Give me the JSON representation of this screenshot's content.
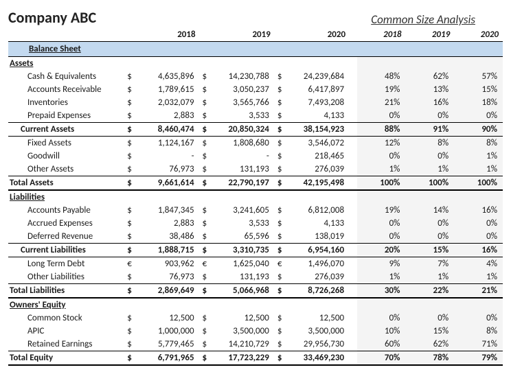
{
  "company": "Company ABC",
  "csa_title": "Common Size Analysis",
  "years": [
    "2018",
    "2019",
    "2020"
  ],
  "section_band": "Balance Sheet",
  "sections": [
    {
      "title": "Assets",
      "rows": [
        {
          "label": "Cash & Equivalents",
          "cur": "$",
          "vals": [
            "4,635,896",
            "14,230,788",
            "24,239,684"
          ],
          "pcts": [
            "48%",
            "62%",
            "57%"
          ],
          "indent": 2
        },
        {
          "label": "Accounts Receivable",
          "cur": "$",
          "vals": [
            "1,789,615",
            "3,050,237",
            "6,417,897"
          ],
          "pcts": [
            "19%",
            "13%",
            "15%"
          ],
          "indent": 2
        },
        {
          "label": "Inventories",
          "cur": "$",
          "vals": [
            "2,032,079",
            "3,565,766",
            "7,493,208"
          ],
          "pcts": [
            "21%",
            "16%",
            "18%"
          ],
          "indent": 2
        },
        {
          "label": "Prepaid Expenses",
          "cur": "$",
          "vals": [
            "2,883",
            "3,533",
            "4,133"
          ],
          "pcts": [
            "0%",
            "0%",
            "0%"
          ],
          "indent": 2
        },
        {
          "label": "Current Assets",
          "cur": "$",
          "vals": [
            "8,460,474",
            "20,850,324",
            "38,154,923"
          ],
          "pcts": [
            "88%",
            "91%",
            "90%"
          ],
          "indent": 1,
          "style": "subtotal"
        },
        {
          "label": "Fixed Assets",
          "cur": "$",
          "vals": [
            "1,124,167",
            "1,808,680",
            "3,546,072"
          ],
          "pcts": [
            "12%",
            "8%",
            "8%"
          ],
          "indent": 2
        },
        {
          "label": "Goodwill",
          "cur": "$",
          "vals": [
            "-",
            "-",
            "218,465"
          ],
          "pcts": [
            "0%",
            "0%",
            "1%"
          ],
          "indent": 2
        },
        {
          "label": "Other Assets",
          "cur": "$",
          "vals": [
            "76,973",
            "131,193",
            "276,039"
          ],
          "pcts": [
            "1%",
            "1%",
            "1%"
          ],
          "indent": 2
        },
        {
          "label": "Total Assets",
          "cur": "$",
          "vals": [
            "9,661,614",
            "22,790,197",
            "42,195,498"
          ],
          "pcts": [
            "100%",
            "100%",
            "100%"
          ],
          "indent": 0,
          "style": "total"
        }
      ]
    },
    {
      "title": "Liabilities",
      "rows": [
        {
          "label": "Accounts Payable",
          "cur": "$",
          "vals": [
            "1,847,345",
            "3,241,605",
            "6,812,008"
          ],
          "pcts": [
            "19%",
            "14%",
            "16%"
          ],
          "indent": 2
        },
        {
          "label": "Accrued Expenses",
          "cur": "$",
          "vals": [
            "2,883",
            "3,533",
            "4,133"
          ],
          "pcts": [
            "0%",
            "0%",
            "0%"
          ],
          "indent": 2
        },
        {
          "label": "Deferred Revenue",
          "cur": "$",
          "vals": [
            "38,486",
            "65,596",
            "138,019"
          ],
          "pcts": [
            "0%",
            "0%",
            "0%"
          ],
          "indent": 2
        },
        {
          "label": "Current Liabilities",
          "cur": "$",
          "vals": [
            "1,888,715",
            "3,310,735",
            "6,954,160"
          ],
          "pcts": [
            "20%",
            "15%",
            "16%"
          ],
          "indent": 1,
          "style": "subtotal"
        },
        {
          "label": "Long Term Debt",
          "cur": "€",
          "vals": [
            "903,962",
            "1,625,040",
            "1,496,070"
          ],
          "pcts": [
            "9%",
            "7%",
            "4%"
          ],
          "indent": 2
        },
        {
          "label": "Other Liabilities",
          "cur": "$",
          "vals": [
            "76,973",
            "131,193",
            "276,039"
          ],
          "pcts": [
            "1%",
            "1%",
            "1%"
          ],
          "indent": 2
        },
        {
          "label": "Total Liabilities",
          "cur": "$",
          "vals": [
            "2,869,649",
            "5,066,968",
            "8,726,268"
          ],
          "pcts": [
            "30%",
            "22%",
            "21%"
          ],
          "indent": 0,
          "style": "total"
        }
      ]
    },
    {
      "title": "Owners' Equity",
      "rows": [
        {
          "label": "Common Stock",
          "cur": "$",
          "vals": [
            "12,500",
            "12,500",
            "12,500"
          ],
          "pcts": [
            "0%",
            "0%",
            "0%"
          ],
          "indent": 2
        },
        {
          "label": "APIC",
          "cur": "$",
          "vals": [
            "1,000,000",
            "3,500,000",
            "3,500,000"
          ],
          "pcts": [
            "10%",
            "15%",
            "8%"
          ],
          "indent": 2
        },
        {
          "label": "Retained Earnings",
          "cur": "$",
          "vals": [
            "5,779,465",
            "14,210,729",
            "29,956,730"
          ],
          "pcts": [
            "60%",
            "62%",
            "71%"
          ],
          "indent": 2
        },
        {
          "label": "Total Equity",
          "cur": "$",
          "vals": [
            "6,791,965",
            "17,723,229",
            "33,469,230"
          ],
          "pcts": [
            "70%",
            "78%",
            "79%"
          ],
          "indent": 0,
          "style": "total"
        }
      ]
    }
  ],
  "chart_data": {
    "type": "table",
    "title": "Balance Sheet with Common Size Analysis",
    "years": [
      2018,
      2019,
      2020
    ],
    "rows": [
      {
        "label": "Cash & Equivalents",
        "values": [
          4635896,
          14230788,
          24239684
        ],
        "pct": [
          48,
          62,
          57
        ]
      },
      {
        "label": "Accounts Receivable",
        "values": [
          1789615,
          3050237,
          6417897
        ],
        "pct": [
          19,
          13,
          15
        ]
      },
      {
        "label": "Inventories",
        "values": [
          2032079,
          3565766,
          7493208
        ],
        "pct": [
          21,
          16,
          18
        ]
      },
      {
        "label": "Prepaid Expenses",
        "values": [
          2883,
          3533,
          4133
        ],
        "pct": [
          0,
          0,
          0
        ]
      },
      {
        "label": "Current Assets",
        "values": [
          8460474,
          20850324,
          38154923
        ],
        "pct": [
          88,
          91,
          90
        ]
      },
      {
        "label": "Fixed Assets",
        "values": [
          1124167,
          1808680,
          3546072
        ],
        "pct": [
          12,
          8,
          8
        ]
      },
      {
        "label": "Goodwill",
        "values": [
          0,
          0,
          218465
        ],
        "pct": [
          0,
          0,
          1
        ]
      },
      {
        "label": "Other Assets",
        "values": [
          76973,
          131193,
          276039
        ],
        "pct": [
          1,
          1,
          1
        ]
      },
      {
        "label": "Total Assets",
        "values": [
          9661614,
          22790197,
          42195498
        ],
        "pct": [
          100,
          100,
          100
        ]
      },
      {
        "label": "Accounts Payable",
        "values": [
          1847345,
          3241605,
          6812008
        ],
        "pct": [
          19,
          14,
          16
        ]
      },
      {
        "label": "Accrued Expenses",
        "values": [
          2883,
          3533,
          4133
        ],
        "pct": [
          0,
          0,
          0
        ]
      },
      {
        "label": "Deferred Revenue",
        "values": [
          38486,
          65596,
          138019
        ],
        "pct": [
          0,
          0,
          0
        ]
      },
      {
        "label": "Current Liabilities",
        "values": [
          1888715,
          3310735,
          6954160
        ],
        "pct": [
          20,
          15,
          16
        ]
      },
      {
        "label": "Long Term Debt",
        "values": [
          903962,
          1625040,
          1496070
        ],
        "pct": [
          9,
          7,
          4
        ]
      },
      {
        "label": "Other Liabilities",
        "values": [
          76973,
          131193,
          276039
        ],
        "pct": [
          1,
          1,
          1
        ]
      },
      {
        "label": "Total Liabilities",
        "values": [
          2869649,
          5066968,
          8726268
        ],
        "pct": [
          30,
          22,
          21
        ]
      },
      {
        "label": "Common Stock",
        "values": [
          12500,
          12500,
          12500
        ],
        "pct": [
          0,
          0,
          0
        ]
      },
      {
        "label": "APIC",
        "values": [
          1000000,
          3500000,
          3500000
        ],
        "pct": [
          10,
          15,
          8
        ]
      },
      {
        "label": "Retained Earnings",
        "values": [
          5779465,
          14210729,
          29956730
        ],
        "pct": [
          60,
          62,
          71
        ]
      },
      {
        "label": "Total Equity",
        "values": [
          6791965,
          17723229,
          33469230
        ],
        "pct": [
          70,
          78,
          79
        ]
      }
    ]
  }
}
